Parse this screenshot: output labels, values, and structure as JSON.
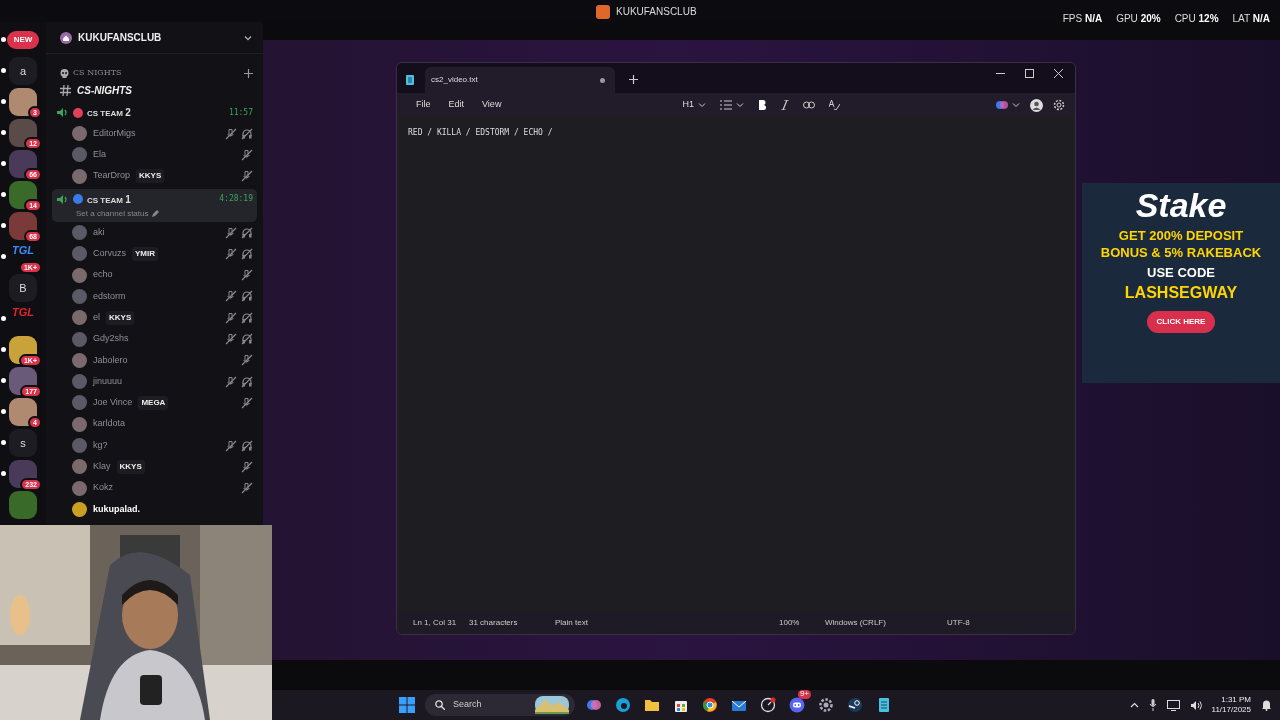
{
  "overlay_bar": {
    "title": "KUKUFANSCLUB",
    "stats": [
      {
        "label": "FPS",
        "value": "N/A"
      },
      {
        "label": "GPU",
        "value": "20%"
      },
      {
        "label": "CPU",
        "value": "12%"
      },
      {
        "label": "LAT",
        "value": "N/A"
      }
    ]
  },
  "server_rail": [
    {
      "kind": "pill",
      "label": "NEW",
      "unread": true
    },
    {
      "kind": "letter",
      "label": "a",
      "unread": true
    },
    {
      "kind": "avatar",
      "badge": "3",
      "unread": true
    },
    {
      "kind": "avatar",
      "badge": "12",
      "unread": true
    },
    {
      "kind": "avatar",
      "badge": "66",
      "unread": true
    },
    {
      "kind": "avatar",
      "badge": "14",
      "unread": true
    },
    {
      "kind": "avatar",
      "badge": "68",
      "unread": true
    },
    {
      "kind": "logo",
      "label": "TGL",
      "color": "#3a8bff",
      "badge": "1K+",
      "unread": true
    },
    {
      "kind": "letter",
      "label": "B",
      "unread": false
    },
    {
      "kind": "logo",
      "label": "TGL",
      "color": "#e0242f",
      "unread": true
    },
    {
      "kind": "avatar",
      "badge": "1K+",
      "unread": true
    },
    {
      "kind": "avatar",
      "badge": "177",
      "unread": true
    },
    {
      "kind": "avatar",
      "badge": "4",
      "unread": true
    },
    {
      "kind": "letter",
      "label": "s",
      "unread": true
    },
    {
      "kind": "avatar",
      "badge": "232",
      "unread": true
    },
    {
      "kind": "avatar",
      "unread": false
    }
  ],
  "channel_panel": {
    "server_name": "KUKUFANSCLUB",
    "category": "CS NIGHTS",
    "text_channel": "CS-NIGHTS",
    "voice_channels": [
      {
        "name": "CS TEAM",
        "number": "2",
        "color": "#e0405a",
        "timer": "11:57",
        "selected": false,
        "members": [
          {
            "name": "EditorMigs",
            "muted": true,
            "deafened": true,
            "highlighted": false
          },
          {
            "name": "Ela",
            "muted": true,
            "deafened": false,
            "highlighted": false
          },
          {
            "name": "TearDrop",
            "tag": "KKYS",
            "muted": true,
            "deafened": false,
            "highlighted": false
          }
        ]
      },
      {
        "name": "CS TEAM",
        "number": "1",
        "color": "#3a7bea",
        "timer": "4:28:19",
        "selected": true,
        "status": "Set a channel status",
        "members": [
          {
            "name": "aki",
            "muted": true,
            "deafened": true,
            "highlighted": false
          },
          {
            "name": "Corvuzs",
            "tag": "YMIR",
            "muted": true,
            "deafened": true,
            "highlighted": false
          },
          {
            "name": "echo",
            "muted": true,
            "deafened": false,
            "highlighted": false
          },
          {
            "name": "edstorm",
            "muted": true,
            "deafened": true,
            "highlighted": false
          },
          {
            "name": "el",
            "tag": "KKYS",
            "muted": true,
            "deafened": true,
            "highlighted": false
          },
          {
            "name": "Gdy2shs",
            "muted": true,
            "deafened": true,
            "highlighted": false
          },
          {
            "name": "Jabolero",
            "muted": true,
            "deafened": false,
            "highlighted": false
          },
          {
            "name": "jinuuuu",
            "muted": true,
            "deafened": true,
            "highlighted": false
          },
          {
            "name": "Joe Vince",
            "tag": "MEGA",
            "muted": true,
            "deafened": false,
            "highlighted": false
          },
          {
            "name": "karldota",
            "muted": false,
            "deafened": false,
            "highlighted": false
          },
          {
            "name": "kg?",
            "muted": true,
            "deafened": true,
            "highlighted": false
          },
          {
            "name": "Klay",
            "tag": "KKYS",
            "muted": true,
            "deafened": false,
            "highlighted": false
          },
          {
            "name": "Kokz",
            "muted": true,
            "deafened": false,
            "highlighted": false
          },
          {
            "name": "kukupalad.",
            "muted": false,
            "deafened": false,
            "highlighted": true
          }
        ]
      }
    ]
  },
  "notepad": {
    "tab_title": "cs2_video.txt",
    "unsaved": true,
    "menu": [
      "File",
      "Edit",
      "View"
    ],
    "heading_button": "H1",
    "content": "RED / KILLA / EDSTORM / ECHO /",
    "status_bar": [
      "Ln 1, Col 31",
      "31 characters",
      "Plain text",
      "100%",
      "Windows (CRLF)",
      "UTF-8"
    ]
  },
  "ad": {
    "brand": "Stake",
    "headline": "GET 200% DEPOSIT BONUS & 5% RAKEBACK",
    "code_label": "USE CODE",
    "code": "LASHSEGWAY",
    "button": "CLICK HERE"
  },
  "taskbar": {
    "search": {
      "placeholder": "Search"
    },
    "chat_badge": "9+",
    "time": "1:31 PM",
    "date": "11/17/2025"
  }
}
